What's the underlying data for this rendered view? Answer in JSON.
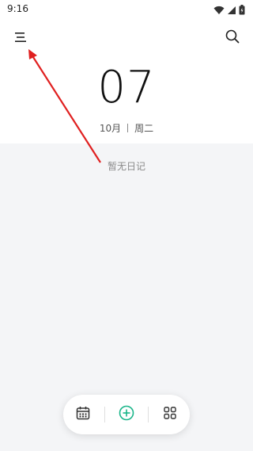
{
  "status_bar": {
    "time": "9:16",
    "icons": [
      "wifi-icon",
      "signal-icon",
      "battery-icon"
    ]
  },
  "top_bar": {
    "menu_icon": "menu-icon",
    "search_icon": "search-icon"
  },
  "date": {
    "day": "07",
    "month": "10月",
    "weekday": "周二"
  },
  "content": {
    "empty_text": "暂无日记"
  },
  "bottom_bar": {
    "icons": [
      "calendar-icon",
      "add-icon",
      "grid-icon"
    ]
  },
  "colors": {
    "accent": "#19b589",
    "background": "#f4f5f7",
    "annotation_arrow": "#e02020"
  }
}
